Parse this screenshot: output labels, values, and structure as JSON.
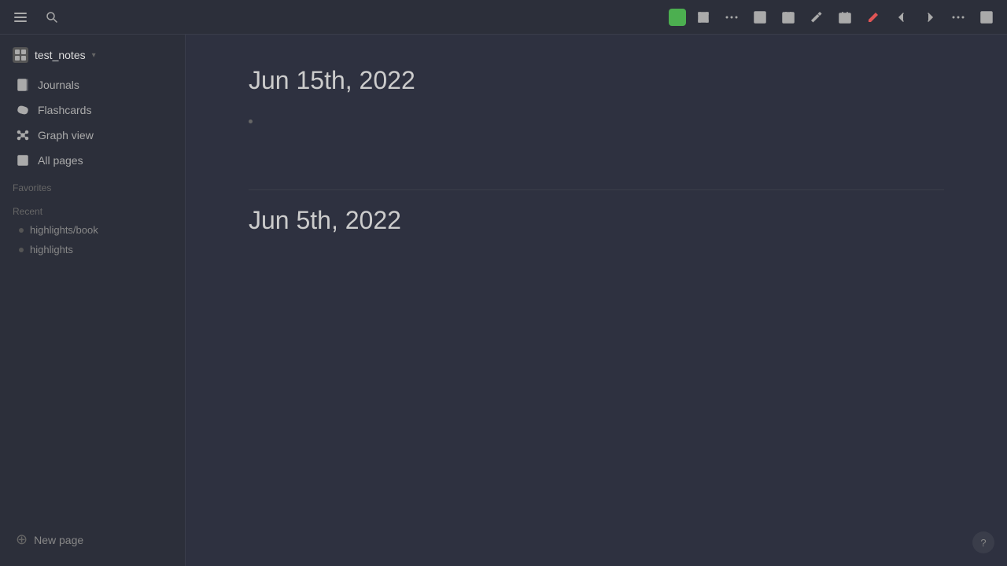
{
  "topbar": {
    "menu_icon": "☰",
    "search_icon": "🔍"
  },
  "toolbar_right": {
    "green_btn_color": "#4caf50",
    "expand_icon": "⛶",
    "more_icon": "⋯",
    "table_icon": "▦",
    "calendar_icon": "📅",
    "tool_icon": "🔧",
    "date_icon": "📆",
    "pen_icon": "✏",
    "back_icon": "←",
    "forward_icon": "→",
    "dots_icon": "•••",
    "layout_icon": "▣"
  },
  "sidebar": {
    "workspace_name": "test_notes",
    "workspace_chevron": "▾",
    "nav_items": [
      {
        "id": "journals",
        "label": "Journals",
        "icon": "journals"
      },
      {
        "id": "flashcards",
        "label": "Flashcards",
        "icon": "flashcards"
      },
      {
        "id": "graph-view",
        "label": "Graph view",
        "icon": "graph"
      },
      {
        "id": "all-pages",
        "label": "All pages",
        "icon": "pages"
      }
    ],
    "favorites_label": "Favorites",
    "recent_label": "Recent",
    "recent_items": [
      {
        "id": "highlights-book",
        "label": "highlights/book"
      },
      {
        "id": "highlights",
        "label": "highlights"
      }
    ],
    "new_page_label": "New page"
  },
  "content": {
    "entries": [
      {
        "id": "entry-jun15",
        "date": "Jun 15th, 2022",
        "bullets": []
      },
      {
        "id": "entry-jun5",
        "date": "Jun 5th, 2022",
        "bullets": []
      }
    ]
  },
  "help": {
    "label": "?"
  }
}
